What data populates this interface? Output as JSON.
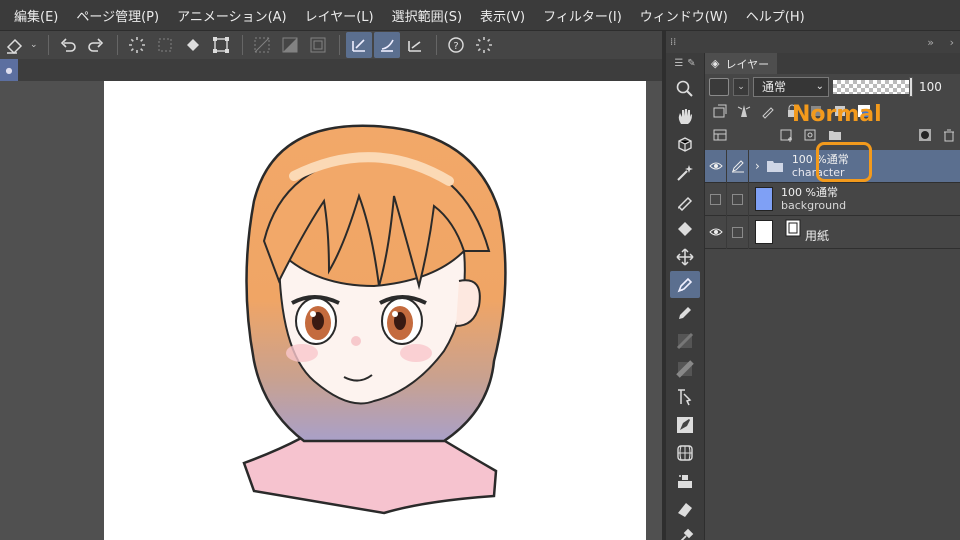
{
  "menu": [
    "編集(E)",
    "ページ管理(P)",
    "アニメーション(A)",
    "レイヤー(L)",
    "選択範囲(S)",
    "表示(V)",
    "フィルター(I)",
    "ウィンドウ(W)",
    "ヘルプ(H)"
  ],
  "layer_panel": {
    "tab_label": "レイヤー",
    "blend_mode": "通常",
    "opacity": "100",
    "layers": [
      {
        "mode": "100 %通常",
        "name": "character",
        "selected": true,
        "visible": true,
        "type": "folder"
      },
      {
        "mode": "100 %通常",
        "name": "background",
        "selected": false,
        "visible": false,
        "type": "raster",
        "thumb_color": "#7fa0f5"
      },
      {
        "mode": "",
        "name": "用紙",
        "selected": false,
        "visible": true,
        "type": "paper",
        "thumb_color": "#ffffff"
      }
    ]
  },
  "annotation": {
    "label": "Normal",
    "color": "#f39a1c"
  },
  "colors": {
    "selection": "#5b6f8f",
    "menu_bg": "#3b3b3b",
    "panel_bg": "#464646"
  }
}
